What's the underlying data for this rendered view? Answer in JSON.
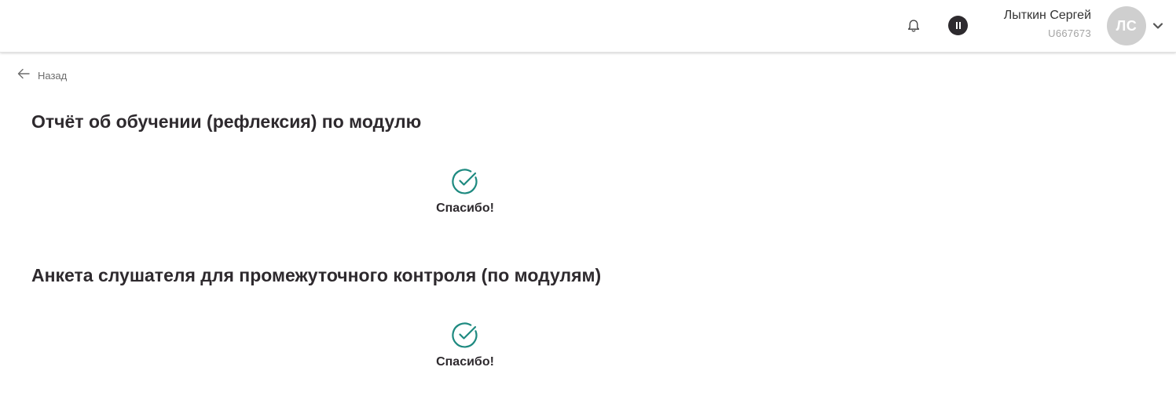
{
  "header": {
    "user": {
      "name": "Лыткин Сергей",
      "id": "U667673",
      "initials": "ЛС"
    },
    "icons": {
      "notifications": "bell-icon",
      "pause": "pause-icon",
      "menu": "chevron-down-icon"
    }
  },
  "back": {
    "label": "Назад",
    "icon": "arrow-left-icon"
  },
  "sections": [
    {
      "title": "Отчёт об обучении (рефлексия) по модулю",
      "status_text": "Спасибо!",
      "status_icon": "check-circle-icon"
    },
    {
      "title": "Анкета слушателя для промежуточного контроля (по модулям)",
      "status_text": "Спасибо!",
      "status_icon": "check-circle-icon"
    }
  ],
  "colors": {
    "accent": "#1e8a80",
    "text": "#2e2a2e",
    "muted": "#a3a3a3",
    "avatar_bg": "#cfcfcf"
  }
}
